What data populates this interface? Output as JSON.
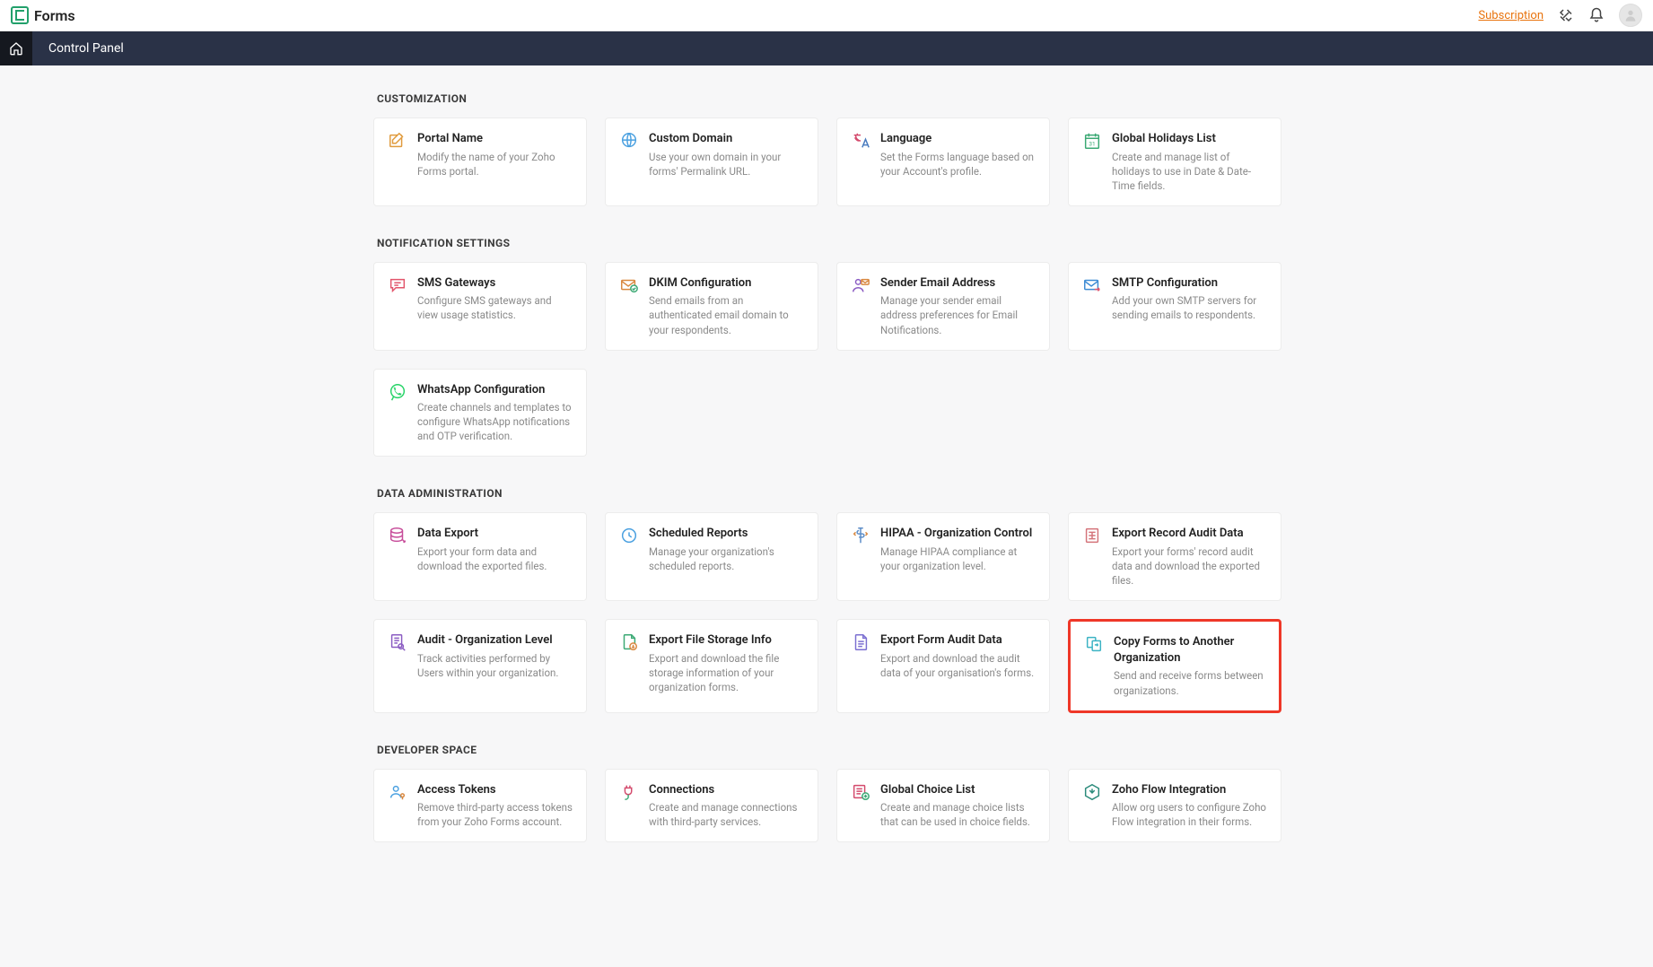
{
  "app": {
    "name": "Forms"
  },
  "topbar": {
    "subscription": "Subscription"
  },
  "nav": {
    "title": "Control Panel"
  },
  "sections": {
    "customization": {
      "heading": "CUSTOMIZATION",
      "cards": {
        "portal_name": {
          "title": "Portal Name",
          "desc": "Modify the name of your Zoho Forms portal."
        },
        "custom_domain": {
          "title": "Custom Domain",
          "desc": "Use your own domain in your forms' Permalink URL."
        },
        "language": {
          "title": "Language",
          "desc": "Set the Forms language based on your Account's profile."
        },
        "holidays": {
          "title": "Global Holidays List",
          "desc": "Create and manage list of holidays to use in Date & Date-Time fields."
        }
      }
    },
    "notification": {
      "heading": "NOTIFICATION SETTINGS",
      "cards": {
        "sms": {
          "title": "SMS Gateways",
          "desc": "Configure SMS gateways and view usage statistics."
        },
        "dkim": {
          "title": "DKIM Configuration",
          "desc": "Send emails from an authenticated email domain to your respondents."
        },
        "sender": {
          "title": "Sender Email Address",
          "desc": "Manage your sender email address preferences for Email Notifications."
        },
        "smtp": {
          "title": "SMTP Configuration",
          "desc": "Add your own SMTP servers for sending emails to respondents."
        },
        "whatsapp": {
          "title": "WhatsApp Configuration",
          "desc": "Create channels and templates to configure WhatsApp notifications and OTP verification."
        }
      }
    },
    "data_admin": {
      "heading": "DATA ADMINISTRATION",
      "cards": {
        "export": {
          "title": "Data Export",
          "desc": "Export your form data and download the exported files."
        },
        "scheduled": {
          "title": "Scheduled Reports",
          "desc": "Manage your organization's scheduled reports."
        },
        "hipaa": {
          "title": "HIPAA - Organization Control",
          "desc": "Manage HIPAA compliance at your organization level."
        },
        "audit_record": {
          "title": "Export Record Audit Data",
          "desc": "Export your forms' record audit data and download the exported files."
        },
        "audit_org": {
          "title": "Audit - Organization Level",
          "desc": "Track activities performed by Users within your organization."
        },
        "file_storage": {
          "title": "Export File Storage Info",
          "desc": "Export and download the file storage information of your organization forms."
        },
        "form_audit": {
          "title": "Export Form Audit Data",
          "desc": "Export and download the audit data of your organisation's forms."
        },
        "copy_forms": {
          "title": "Copy Forms to Another Organization",
          "desc": "Send and receive forms between organizations."
        }
      }
    },
    "developer": {
      "heading": "DEVELOPER SPACE",
      "cards": {
        "tokens": {
          "title": "Access Tokens",
          "desc": "Remove third-party access tokens from your Zoho Forms account."
        },
        "connections": {
          "title": "Connections",
          "desc": "Create and manage connections with third-party services."
        },
        "choice": {
          "title": "Global Choice List",
          "desc": "Create and manage choice lists that can be used in choice fields."
        },
        "flow": {
          "title": "Zoho Flow Integration",
          "desc": "Allow org users to configure Zoho Flow integration in their forms."
        }
      }
    }
  }
}
